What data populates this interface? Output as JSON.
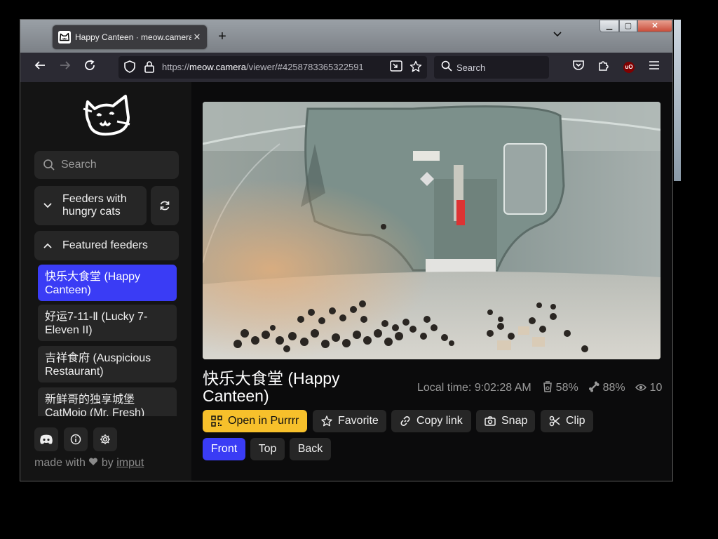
{
  "browser": {
    "tab_title": "Happy Canteen · meow.camera",
    "tab_close": "✕",
    "new_tab": "+",
    "url_prefix": "https://",
    "url_host": "meow.camera",
    "url_path": "/viewer/#4258783365322591",
    "search_placeholder": "Search",
    "ublock_badge": "uO"
  },
  "sidebar": {
    "search_placeholder": "Search",
    "groups": [
      {
        "label": "Feeders with hungry cats",
        "expanded": false
      },
      {
        "label": "Featured feeders",
        "expanded": true
      }
    ],
    "feeders": [
      {
        "label": "快乐大食堂 (Happy Canteen)",
        "active": true
      },
      {
        "label": "好运7-11-Ⅱ (Lucky 7-Eleven II)",
        "active": false
      },
      {
        "label": "吉祥食府 (Auspicious Restaurant)",
        "active": false
      },
      {
        "label": "新鲜哥的独享城堡 CatMojo (Mr. Fresh)",
        "active": false
      }
    ],
    "footer_prefix": "made with",
    "footer_by": "by",
    "footer_link": "imput"
  },
  "viewer": {
    "title": "快乐大食堂 (Happy Canteen)",
    "local_time": "Local time: 9:02:28 AM",
    "food_level": "58%",
    "feed_level": "88%",
    "viewers": "10",
    "actions": [
      {
        "label": "Open in Purrrr",
        "icon": "qr-code-icon"
      },
      {
        "label": "Favorite",
        "icon": "star-icon"
      },
      {
        "label": "Copy link",
        "icon": "link-icon"
      },
      {
        "label": "Snap",
        "icon": "camera-icon"
      },
      {
        "label": "Clip",
        "icon": "scissors-icon"
      }
    ],
    "views": [
      {
        "label": "Front",
        "active": true
      },
      {
        "label": "Top",
        "active": false
      },
      {
        "label": "Back",
        "active": false
      }
    ]
  },
  "colors": {
    "accent_blue": "#3a3cf5",
    "accent_yellow": "#f7c02b",
    "sidebar_bg": "#141414",
    "button_bg": "#262626"
  }
}
